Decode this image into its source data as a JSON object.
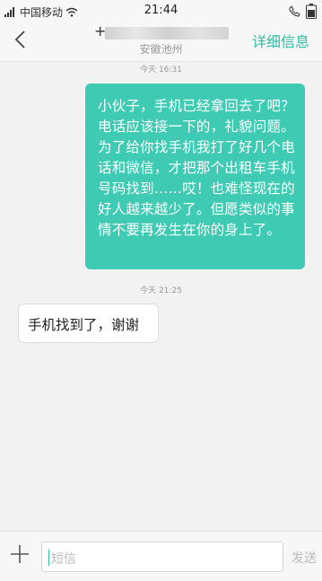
{
  "status_bar": {
    "carrier": "中国移动",
    "time": "21:44"
  },
  "header": {
    "contact_prefix": "+",
    "location": "安徽池州",
    "details_label": "详细信息"
  },
  "messages": [
    {
      "timestamp": "今天 16:31",
      "direction": "outgoing",
      "text": "小伙子，手机已经拿回去了吧？电话应该接一下的，礼貌问题。为了给你找手机我打了好几个电话和微信，才把那个出租车手机号码找到……哎！也难怪现在的好人越来越少了。但愿类似的事情不要再发生在你的身上了。"
    },
    {
      "timestamp": "今天  21:25",
      "direction": "incoming",
      "text": "手机找到了，谢谢"
    }
  ],
  "composer": {
    "placeholder": "短信",
    "send_label": "发送"
  },
  "colors": {
    "accent": "#35bda3",
    "outgoing_bubble": "#3fcab4"
  },
  "icons": [
    "signal-icon",
    "wifi-icon",
    "phone-icon",
    "battery-icon",
    "back-arrow-icon",
    "plus-icon"
  ]
}
